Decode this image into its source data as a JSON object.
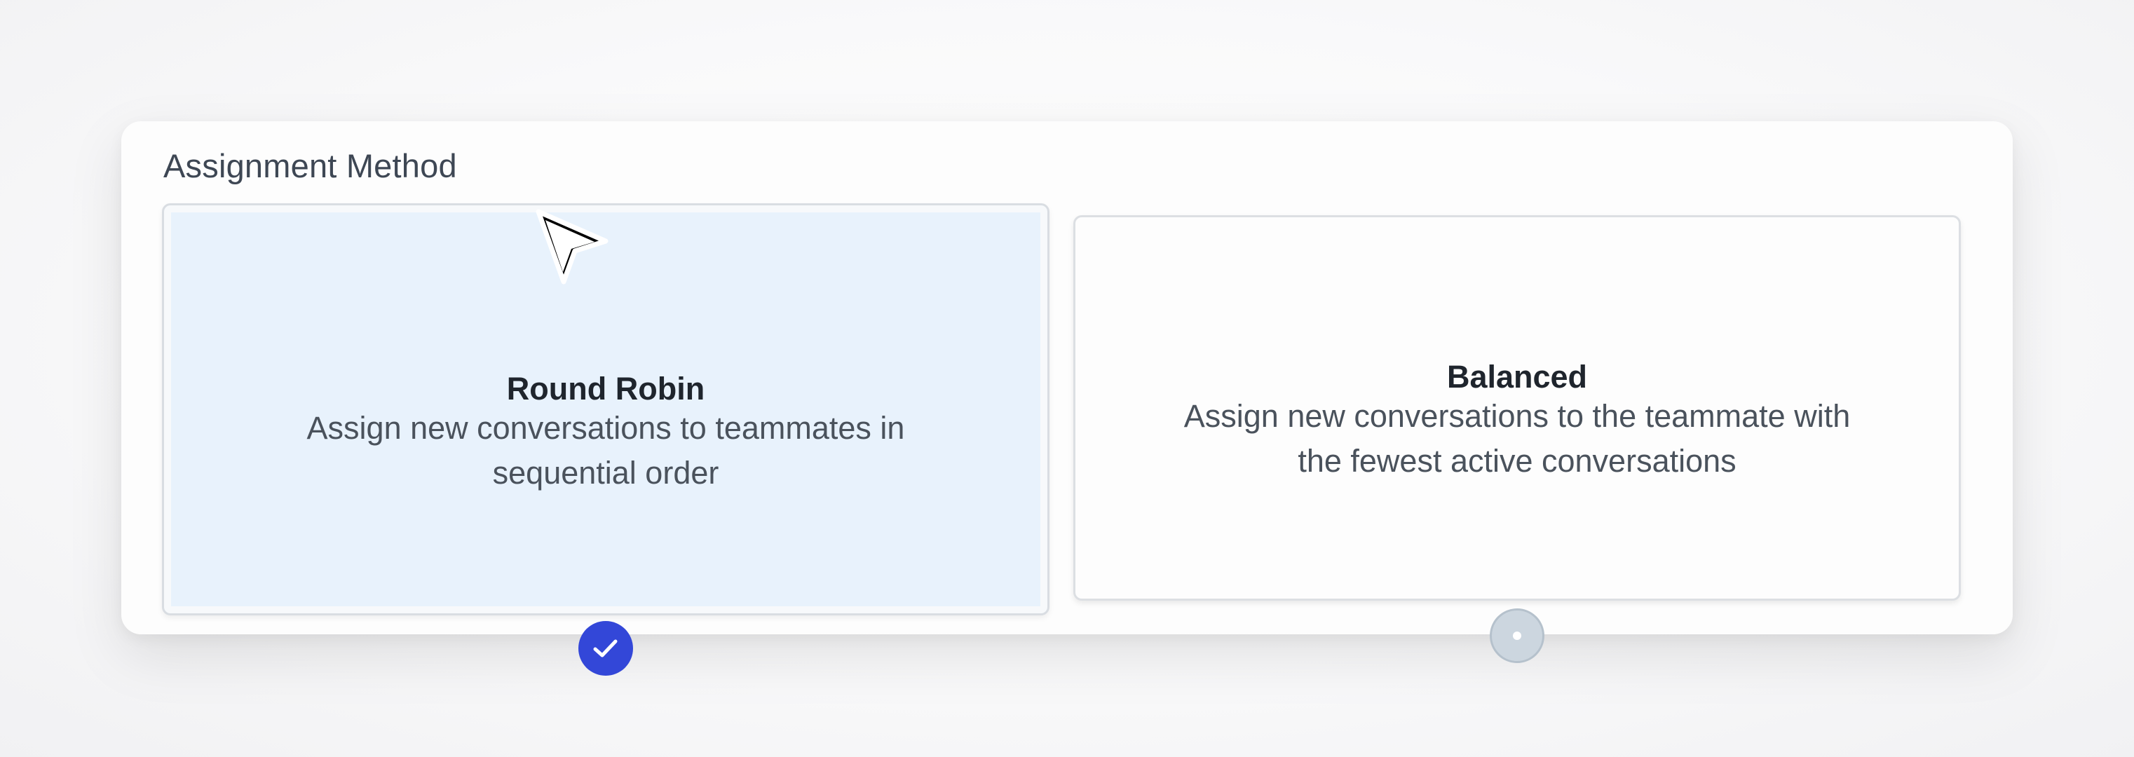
{
  "section": {
    "title": "Assignment Method"
  },
  "options": [
    {
      "title": "Round Robin",
      "description": "Assign new conversations to teammates in sequential order",
      "selected": true
    },
    {
      "title": "Balanced",
      "description": "Assign new conversations to the teammate with the fewest active conversations",
      "selected": false
    }
  ],
  "colors": {
    "selected_card_bg": "#e8f2fc",
    "selected_radio": "#3347d8",
    "unselected_radio": "#ccd6df",
    "title_text": "#1f252d",
    "body_text": "#4a525c"
  },
  "icons": {
    "selected_indicator": "check-icon",
    "pointer": "mouse-cursor-icon"
  }
}
